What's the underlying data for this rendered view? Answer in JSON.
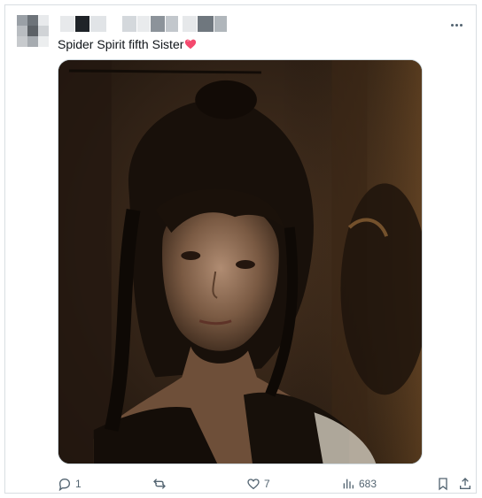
{
  "post": {
    "caption": "Spider Spirit fifth Sister",
    "caption_emoji": "heart",
    "stats": {
      "replies": "1",
      "likes": "7",
      "views": "683"
    }
  },
  "colors": {
    "text": "#0f1419",
    "muted": "#536471",
    "border": "#d9dee2",
    "heart": "#f4496e"
  },
  "icons": [
    "more-icon",
    "reply-icon",
    "repost-icon",
    "like-icon",
    "views-icon",
    "bookmark-icon",
    "share-icon"
  ]
}
